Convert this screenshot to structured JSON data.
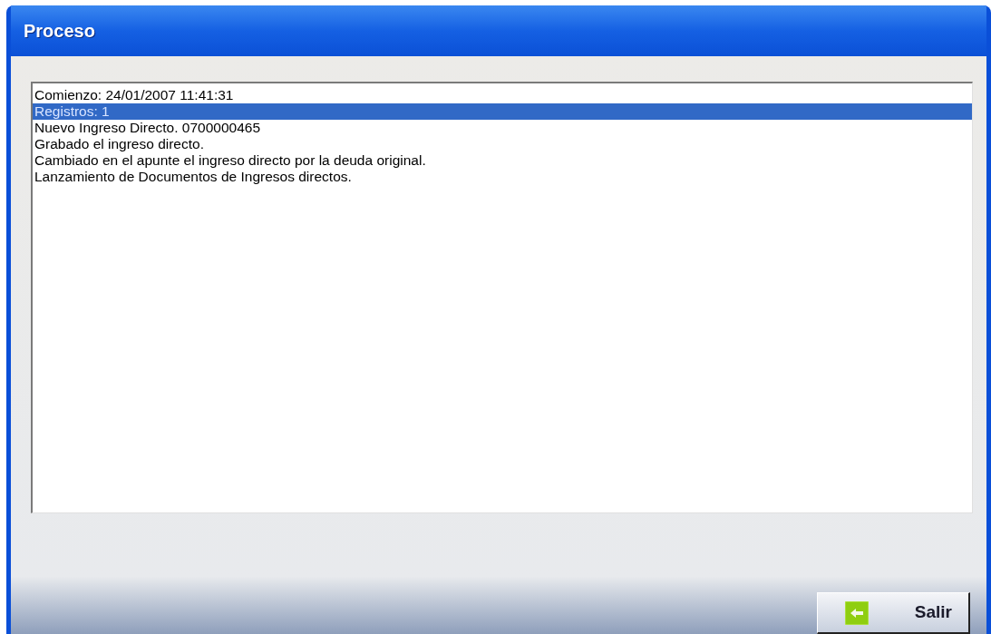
{
  "window": {
    "title": "Proceso"
  },
  "log": [
    {
      "text": "Comienzo: 24/01/2007 11:41:31",
      "selected": false
    },
    {
      "text": "Registros: 1",
      "selected": true
    },
    {
      "text": "Nuevo Ingreso Directo. 0700000465",
      "selected": false
    },
    {
      "text": "Grabado el ingreso directo.",
      "selected": false
    },
    {
      "text": "Cambiado en el apunte el ingreso directo por la deuda original.",
      "selected": false
    },
    {
      "text": "Lanzamiento de Documentos de Ingresos directos.",
      "selected": false
    }
  ],
  "buttons": [
    {
      "label": "Salir"
    }
  ]
}
